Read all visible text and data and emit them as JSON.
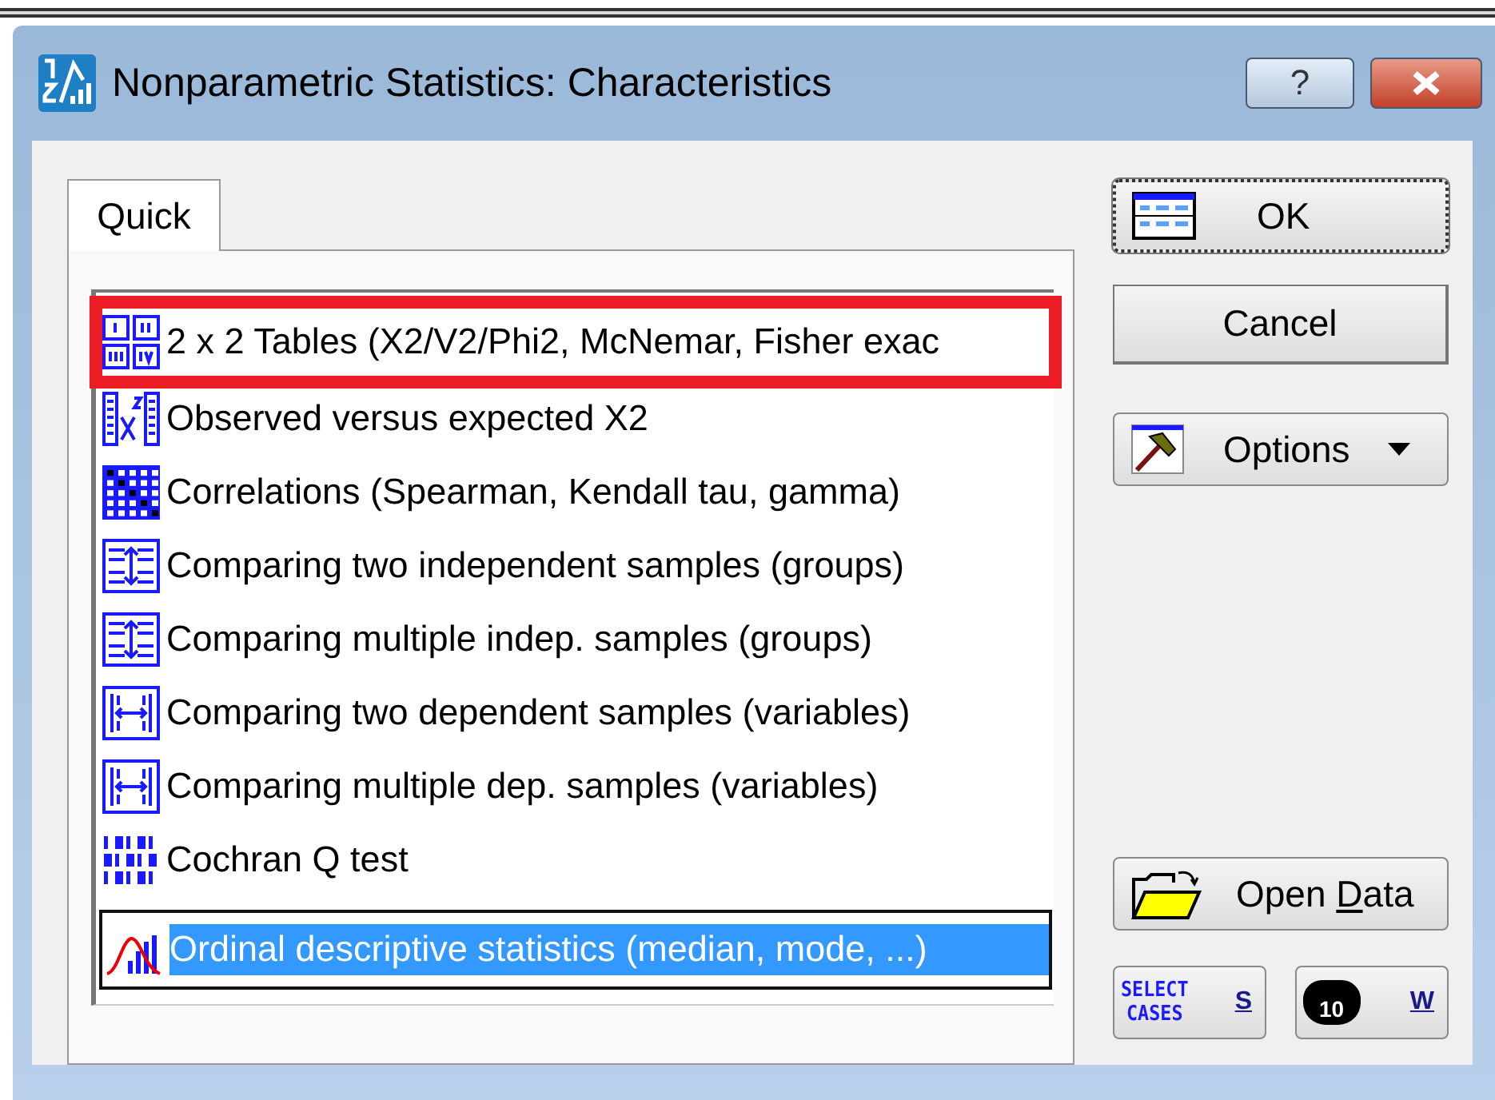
{
  "window": {
    "title": "Nonparametric Statistics: Characteristics",
    "help_glyph": "?"
  },
  "tabs": [
    {
      "label": "Quick",
      "selected": true
    }
  ],
  "list": [
    {
      "kind": "table2x2",
      "label": "2 x 2 Tables (X2/V2/Phi2, McNemar, Fisher exac",
      "selected": false,
      "highlighted": true
    },
    {
      "kind": "chisq",
      "label": "Observed versus expected X2",
      "selected": false,
      "highlighted": false
    },
    {
      "kind": "matrix",
      "label": "Correlations (Spearman, Kendall tau, gamma)",
      "selected": false,
      "highlighted": false
    },
    {
      "kind": "indep2",
      "label": "Comparing two independent samples (groups)",
      "selected": false,
      "highlighted": false
    },
    {
      "kind": "indepn",
      "label": "Comparing multiple indep. samples (groups)",
      "selected": false,
      "highlighted": false
    },
    {
      "kind": "dep2",
      "label": "Comparing two dependent samples (variables)",
      "selected": false,
      "highlighted": false
    },
    {
      "kind": "depn",
      "label": "Comparing multiple dep. samples (variables)",
      "selected": false,
      "highlighted": false
    },
    {
      "kind": "binary",
      "label": "Cochran Q test",
      "selected": false,
      "highlighted": false
    },
    {
      "kind": "distribution",
      "label": "Ordinal descriptive statistics (median, mode, ...)",
      "selected": true,
      "highlighted": false
    }
  ],
  "buttons": {
    "ok": "OK",
    "cancel": "Cancel",
    "options": "Options",
    "open_data": {
      "before": "Open ",
      "mnemonic": "D",
      "after": "ata"
    },
    "select_cases": {
      "icon_lines": [
        "SELECT",
        "CASES"
      ],
      "mnemonic": "S"
    },
    "weight": {
      "icon_text": "10",
      "mnemonic": "W"
    }
  }
}
